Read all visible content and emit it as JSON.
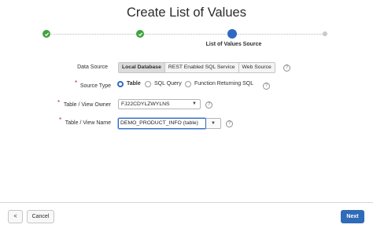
{
  "dialog": {
    "title": "Create List of Values"
  },
  "wizard": {
    "current_step_label": "List of Values Source",
    "steps": [
      {
        "state": "completed"
      },
      {
        "state": "completed"
      },
      {
        "state": "current",
        "label": "List of Values Source"
      },
      {
        "state": "pending"
      }
    ]
  },
  "form": {
    "data_source": {
      "label": "Data Source",
      "options": [
        "Local Database",
        "REST Enabled SQL Service",
        "Web Source"
      ],
      "selected": "Local Database"
    },
    "source_type": {
      "label": "Source Type",
      "required": true,
      "options": [
        "Table",
        "SQL Query",
        "Function Returning SQL"
      ],
      "selected": "Table"
    },
    "table_owner": {
      "label": "Table / View Owner",
      "required": true,
      "value": "FJ22CDYLZWYLNS"
    },
    "table_name": {
      "label": "Table / View Name",
      "required": true,
      "value": "DEMO_PRODUCT_INFO (table)"
    },
    "help_icon_text": "?"
  },
  "footer": {
    "back_label": "<",
    "cancel_label": "Cancel",
    "next_label": "Next"
  },
  "colors": {
    "completed": "#3fa33f",
    "current": "#3069c2",
    "primary_button": "#2f6bb8",
    "required": "#c4252a"
  }
}
